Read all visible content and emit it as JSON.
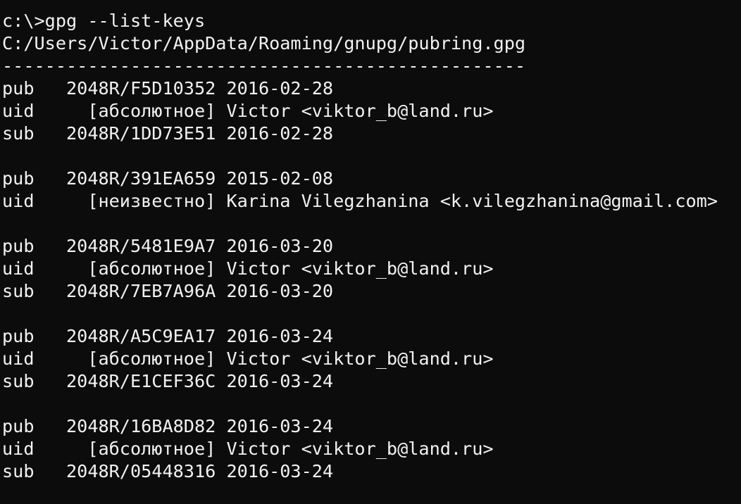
{
  "terminal": {
    "background_color": "#0c0c0c",
    "text_color": "#f2f2f2",
    "lines": [
      "c:\\>gpg --list-keys",
      "C:/Users/Victor/AppData/Roaming/gnupg/pubring.gpg",
      "-------------------------------------------------",
      "pub   2048R/F5D10352 2016-02-28",
      "uid     [абсолютное] Victor <viktor_b@land.ru>",
      "sub   2048R/1DD73E51 2016-02-28",
      "",
      "pub   2048R/391EA659 2015-02-08",
      "uid     [неизвестно] Karina Vilegzhanina <k.vilegzhanina@gmail.com>",
      "",
      "pub   2048R/5481E9A7 2016-03-20",
      "uid     [абсолютное] Victor <viktor_b@land.ru>",
      "sub   2048R/7EB7A96A 2016-03-20",
      "",
      "pub   2048R/A5C9EA17 2016-03-24",
      "uid     [абсолютное] Victor <viktor_b@land.ru>",
      "sub   2048R/E1CEF36C 2016-03-24",
      "",
      "pub   2048R/16BA8D82 2016-03-24",
      "uid     [абсолютное] Victor <viktor_b@land.ru>",
      "sub   2048R/05448316 2016-03-24"
    ]
  }
}
